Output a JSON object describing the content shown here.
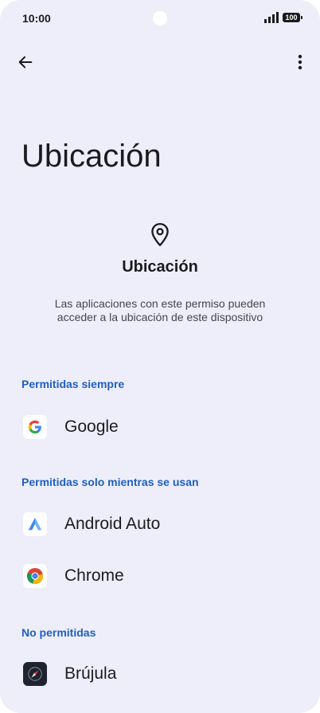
{
  "status_bar": {
    "time": "10:00",
    "battery": "100"
  },
  "toolbar": {
    "back_icon": "arrow-back-icon",
    "menu_icon": "more-vert-icon"
  },
  "page_title": "Ubicación",
  "header": {
    "icon": "location-pin-icon",
    "title": "Ubicación",
    "description": "Las aplicaciones con este permiso pueden acceder a la ubicación de este dispositivo"
  },
  "sections": [
    {
      "label": "Permitidas siempre",
      "apps": [
        {
          "name": "Google",
          "icon": "google-icon"
        }
      ]
    },
    {
      "label": "Permitidas solo mientras se usan",
      "apps": [
        {
          "name": "Android Auto",
          "icon": "android-auto-icon"
        },
        {
          "name": "Chrome",
          "icon": "chrome-icon"
        }
      ]
    },
    {
      "label": "No permitidas",
      "apps": [
        {
          "name": "Brújula",
          "icon": "compass-icon"
        }
      ]
    }
  ],
  "colors": {
    "background": "#eeeefb",
    "accent": "#1f5fbf",
    "text": "#1b1b1f"
  }
}
